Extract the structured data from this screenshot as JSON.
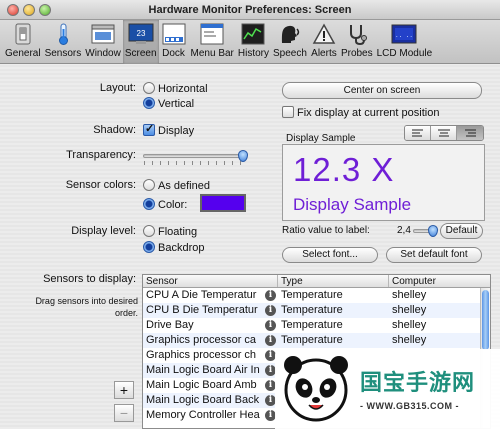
{
  "window": {
    "title": "Hardware Monitor Preferences: Screen"
  },
  "toolbar": {
    "items": [
      {
        "label": "General",
        "icon": "light-switch-icon"
      },
      {
        "label": "Sensors",
        "icon": "thermometer-icon"
      },
      {
        "label": "Window",
        "icon": "window-icon"
      },
      {
        "label": "Screen",
        "icon": "screen-icon",
        "icon_text": "23",
        "selected": true
      },
      {
        "label": "Dock",
        "icon": "dock-icon"
      },
      {
        "label": "Menu Bar",
        "icon": "menu-bar-icon"
      },
      {
        "label": "History",
        "icon": "history-graph-icon"
      },
      {
        "label": "Speech",
        "icon": "speech-head-icon"
      },
      {
        "label": "Alerts",
        "icon": "alert-icon"
      },
      {
        "label": "Probes",
        "icon": "stethoscope-icon"
      },
      {
        "label": "LCD Module",
        "icon": "lcd-module-icon"
      }
    ]
  },
  "settings": {
    "layout_label": "Layout:",
    "layout_options": [
      "Horizontal",
      "Vertical"
    ],
    "layout_selected": "Vertical",
    "shadow_label": "Shadow:",
    "shadow_option": "Display",
    "shadow_checked": true,
    "transparency_label": "Transparency:",
    "transparency_value": 1.0,
    "sensor_colors_label": "Sensor colors:",
    "sensor_colors_options": [
      "As defined",
      "Color:"
    ],
    "sensor_colors_selected": "Color:",
    "sensor_color": "#5500ee",
    "display_level_label": "Display level:",
    "display_level_options": [
      "Floating",
      "Backdrop"
    ],
    "display_level_selected": "Backdrop"
  },
  "display": {
    "center_button": "Center on screen",
    "fix_position_label": "Fix display at current position",
    "fix_position_checked": false,
    "sample_title": "Display Sample",
    "sample_value": "12.3 X",
    "sample_text": "Display Sample",
    "sample_color": "#6f1fd6",
    "alignment_selected": "right",
    "ratio_label": "Ratio value to label:",
    "ratio_value": "2,4",
    "ratio_slider": 0.8,
    "default_button": "Default",
    "select_font_button": "Select font...",
    "set_default_font_button": "Set default font"
  },
  "sensors": {
    "label": "Sensors to display:",
    "hint": "Drag sensors into desired order.",
    "columns": [
      "Sensor",
      "Type",
      "Computer"
    ],
    "rows": [
      {
        "sensor": "CPU A Die Temperatur",
        "type": "Temperature",
        "computer": "shelley"
      },
      {
        "sensor": "CPU B Die Temperatur",
        "type": "Temperature",
        "computer": "shelley"
      },
      {
        "sensor": "Drive Bay",
        "type": "Temperature",
        "computer": "shelley"
      },
      {
        "sensor": "Graphics processor ca",
        "type": "Temperature",
        "computer": "shelley"
      },
      {
        "sensor": "Graphics processor ch",
        "type": "",
        "computer": ""
      },
      {
        "sensor": "Main Logic Board Air In",
        "type": "",
        "computer": ""
      },
      {
        "sensor": "Main Logic Board Amb",
        "type": "",
        "computer": ""
      },
      {
        "sensor": "Main Logic Board Back",
        "type": "",
        "computer": ""
      },
      {
        "sensor": "Memory Controller Hea",
        "type": "",
        "computer": ""
      }
    ],
    "add_button": "+",
    "remove_button": "−"
  },
  "watermark": {
    "text": "国宝手游网",
    "url": "- WWW.GB315.COM -"
  }
}
